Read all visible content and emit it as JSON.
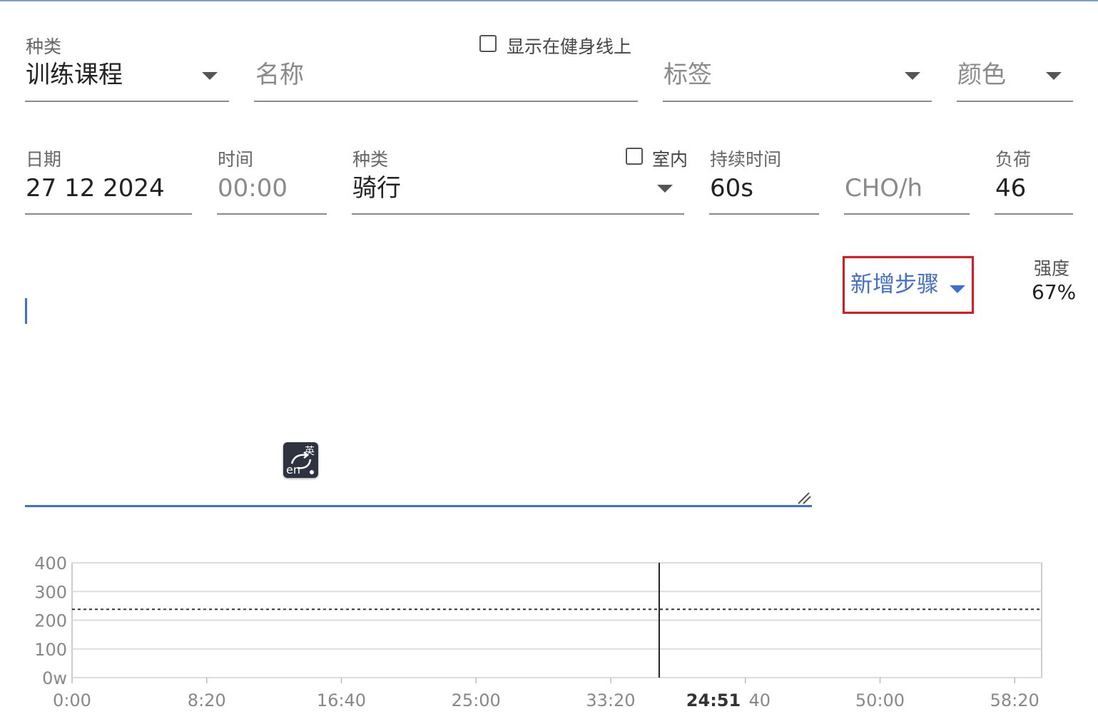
{
  "row1": {
    "category_label": "种类",
    "category_value": "训练课程",
    "show_on_fitness_label": "显示在健身线上",
    "name_placeholder": "名称",
    "tags_placeholder": "标签",
    "color_placeholder": "颜色"
  },
  "row2": {
    "date_label": "日期",
    "date_value": "27 12 2024",
    "time_label": "时间",
    "time_placeholder": "00:00",
    "sport_label": "种类",
    "sport_value": "骑行",
    "indoor_label": "室内",
    "duration_label": "持续时间",
    "duration_value": "60s",
    "cho_placeholder": "CHO/h",
    "load_label": "负荷",
    "load_value": "46"
  },
  "add_step": {
    "label": "新增步骤"
  },
  "intensity": {
    "label": "强度",
    "value": "67%"
  },
  "ime": {
    "cn": "英",
    "en": "en"
  },
  "chart_data": {
    "type": "line",
    "y_ticks": [
      "400",
      "300",
      "200",
      "100",
      "0w"
    ],
    "y_values": [
      400,
      300,
      200,
      100,
      0
    ],
    "ylim": [
      0,
      400
    ],
    "x_ticks": [
      "0:00",
      "8:20",
      "16:40",
      "25:00",
      "33:20",
      "40",
      "50:00",
      "58:20"
    ],
    "x_tick_seconds": [
      0,
      500,
      1000,
      1500,
      2000,
      2500,
      3000,
      3500
    ],
    "xlim_seconds": [
      0,
      3600
    ],
    "ftp_reference_watts": 238,
    "cursor_time_label": "24:51",
    "cursor_seconds": 2180,
    "grid": true,
    "colors": {
      "grid": "#dddddd",
      "axis": "#bbbbbb",
      "cursor": "#222222",
      "ref": "#333333",
      "tick_text": "#888888"
    }
  }
}
